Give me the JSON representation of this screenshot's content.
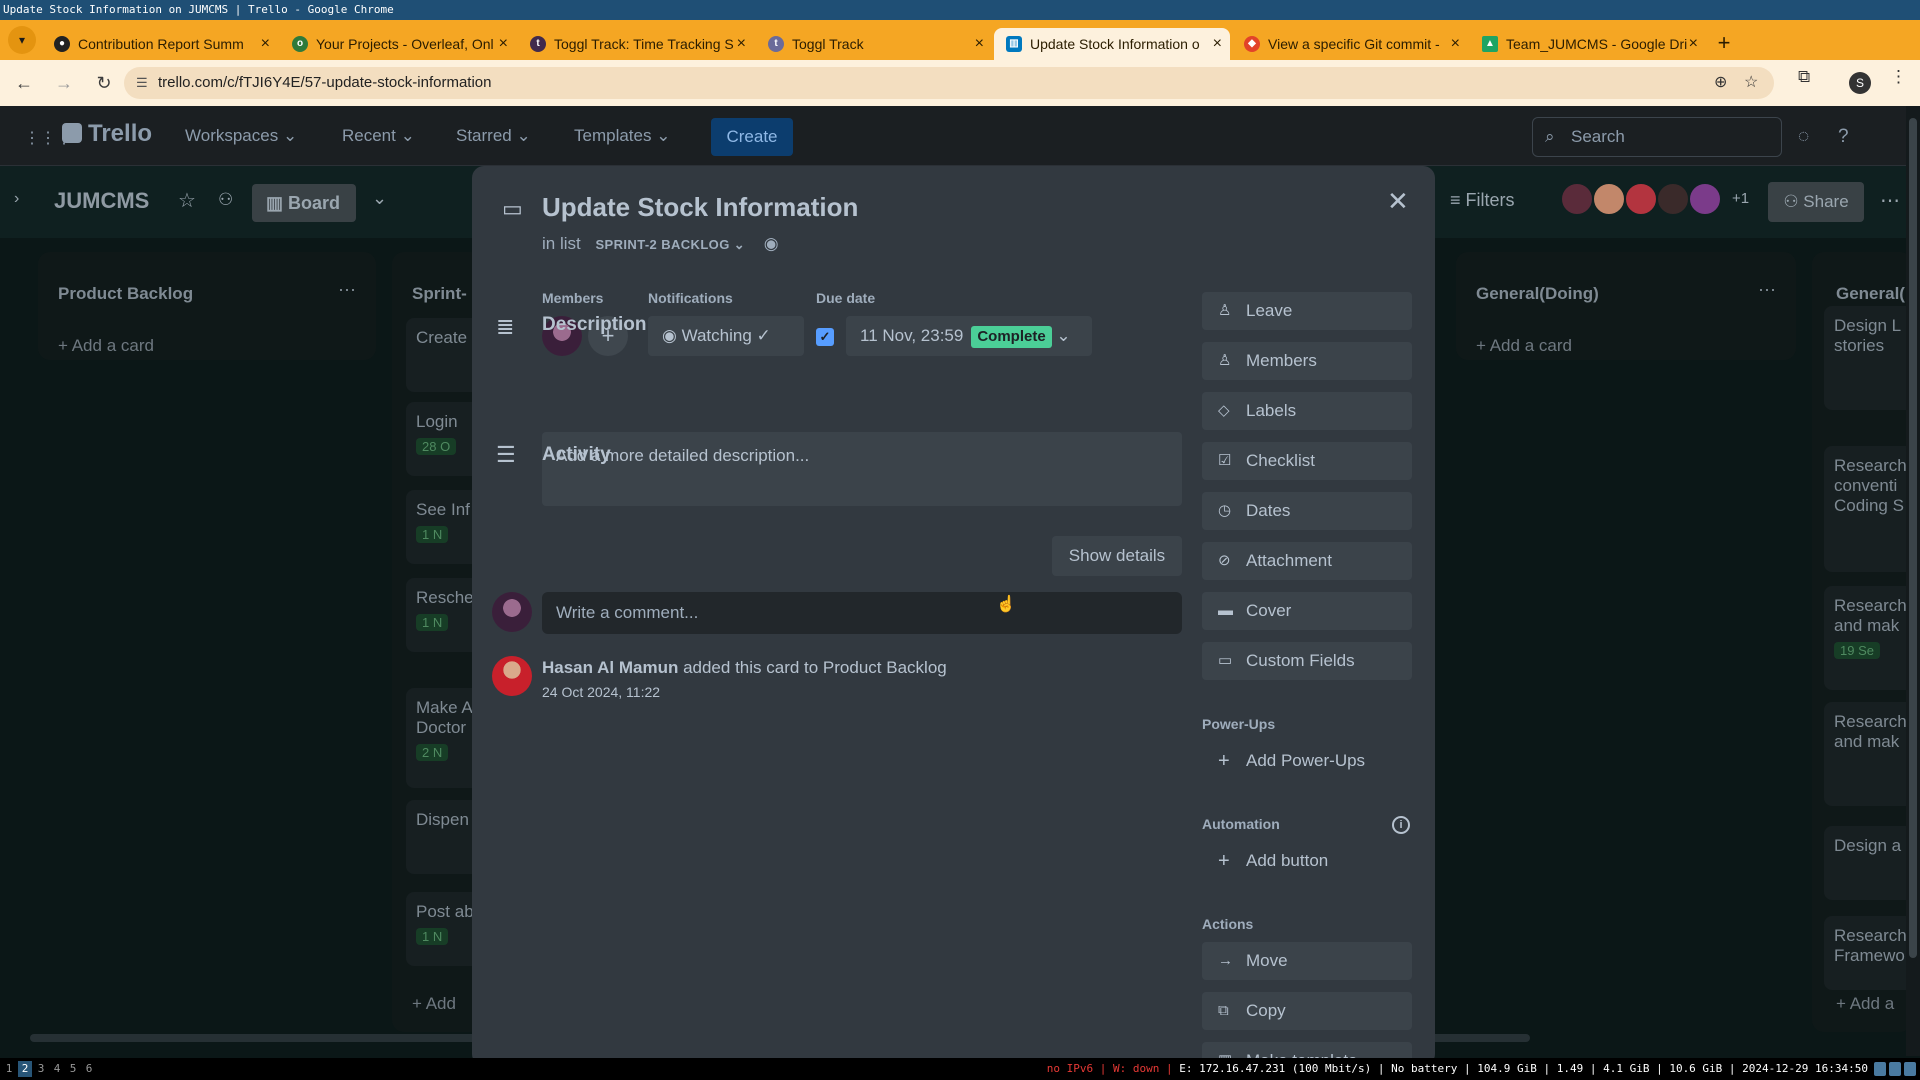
{
  "window_title": "Update Stock Information on JUMCMS | Trello - Google Chrome",
  "tabs": [
    {
      "label": "Contribution Report Summ",
      "icon": "github-icon",
      "active": false
    },
    {
      "label": "Your Projects - Overleaf, Onl",
      "icon": "overleaf-icon",
      "active": false
    },
    {
      "label": "Toggl Track: Time Tracking S",
      "icon": "toggl-icon",
      "active": false
    },
    {
      "label": "Toggl Track",
      "icon": "toggl-icon",
      "active": false
    },
    {
      "label": "Update Stock Information o",
      "icon": "trello-icon",
      "active": true
    },
    {
      "label": "View a specific Git commit -",
      "icon": "gitlab-icon",
      "active": false
    },
    {
      "label": "Team_JUMCMS - Google Dri",
      "icon": "drive-icon",
      "active": false
    }
  ],
  "address": {
    "url": "trello.com/c/fTJI6Y4E/57-update-stock-information"
  },
  "profile_initial": "S",
  "trello_nav": {
    "logo": "Trello",
    "workspaces": "Workspaces",
    "recent": "Recent",
    "starred": "Starred",
    "templates": "Templates",
    "create": "Create",
    "search_placeholder": "Search"
  },
  "board": {
    "name": "JUMCMS",
    "view": "Board",
    "filters": "Filters",
    "extra_members": "+1",
    "share": "Share"
  },
  "lists": {
    "product_backlog": {
      "title": "Product Backlog",
      "add": "Add a card"
    },
    "sprint": {
      "title": "Sprint-",
      "cards": [
        {
          "title": "Create",
          "badge": ""
        },
        {
          "title": "Login",
          "badge": "28 O"
        },
        {
          "title": "See Inf",
          "badge": "1 N"
        },
        {
          "title": "Resche",
          "badge": "1 N"
        },
        {
          "title": "Make A",
          "badge": "2 N",
          "sub": "Doctor"
        },
        {
          "title": "Dispen",
          "badge": ""
        },
        {
          "title": "Post ab",
          "badge": "1 N"
        }
      ],
      "add": "Add"
    },
    "general_doing": {
      "title": "General(Doing)",
      "add": "Add a card"
    },
    "general": {
      "title": "General(",
      "cards": [
        {
          "title": "Design L",
          "sub": "stories",
          "badge": ""
        },
        {
          "title": "Research",
          "sub": "conventi",
          "sub2": "Coding S",
          "badge": ""
        },
        {
          "title": "Research",
          "sub": "and mak",
          "badge": "19 Se"
        },
        {
          "title": "Research",
          "sub": "and mak",
          "badge": ""
        },
        {
          "title": "Design a",
          "badge": ""
        },
        {
          "title": "Research",
          "sub": "Framewo",
          "badge": ""
        }
      ],
      "add": "Add a"
    }
  },
  "card": {
    "title": "Update Stock Information",
    "in_list_prefix": "in list",
    "list_name": "SPRINT-2 BACKLOG",
    "members_label": "Members",
    "notifications_label": "Notifications",
    "watching": "Watching",
    "due_label": "Due date",
    "due_value": "11 Nov, 23:59",
    "due_status": "Complete",
    "description_title": "Description",
    "description_placeholder": "Add a more detailed description...",
    "activity_title": "Activity",
    "show_details": "Show details",
    "comment_placeholder": "Write a comment...",
    "activity": {
      "user": "Hasan Al Mamun",
      "action": " added this card to Product Backlog",
      "time": "24 Oct 2024, 11:22"
    }
  },
  "sidebar": {
    "add_to_card": [
      "Leave",
      "Members",
      "Labels",
      "Checklist",
      "Dates",
      "Attachment",
      "Cover",
      "Custom Fields"
    ],
    "powerups_label": "Power-Ups",
    "add_powerups": "Add Power-Ups",
    "automation_label": "Automation",
    "add_button": "Add button",
    "actions_label": "Actions",
    "actions": [
      "Move",
      "Copy",
      "Make template"
    ]
  },
  "taskbar": {
    "workspaces": [
      "1",
      "2",
      "3",
      "4",
      "5",
      "6"
    ],
    "active_workspace": "2",
    "net_warn": "no IPv6 | W: down |",
    "status": "E: 172.16.47.231 (100 Mbit/s) | No battery | 104.9 GiB | 1.49 | 4.1 GiB | 10.6 GiB | 2024-12-29 16:34:50"
  },
  "colors": {
    "accent": "#579dff",
    "complete": "#4bce97",
    "tabstrip": "#f5a623",
    "modal": "#323940"
  }
}
